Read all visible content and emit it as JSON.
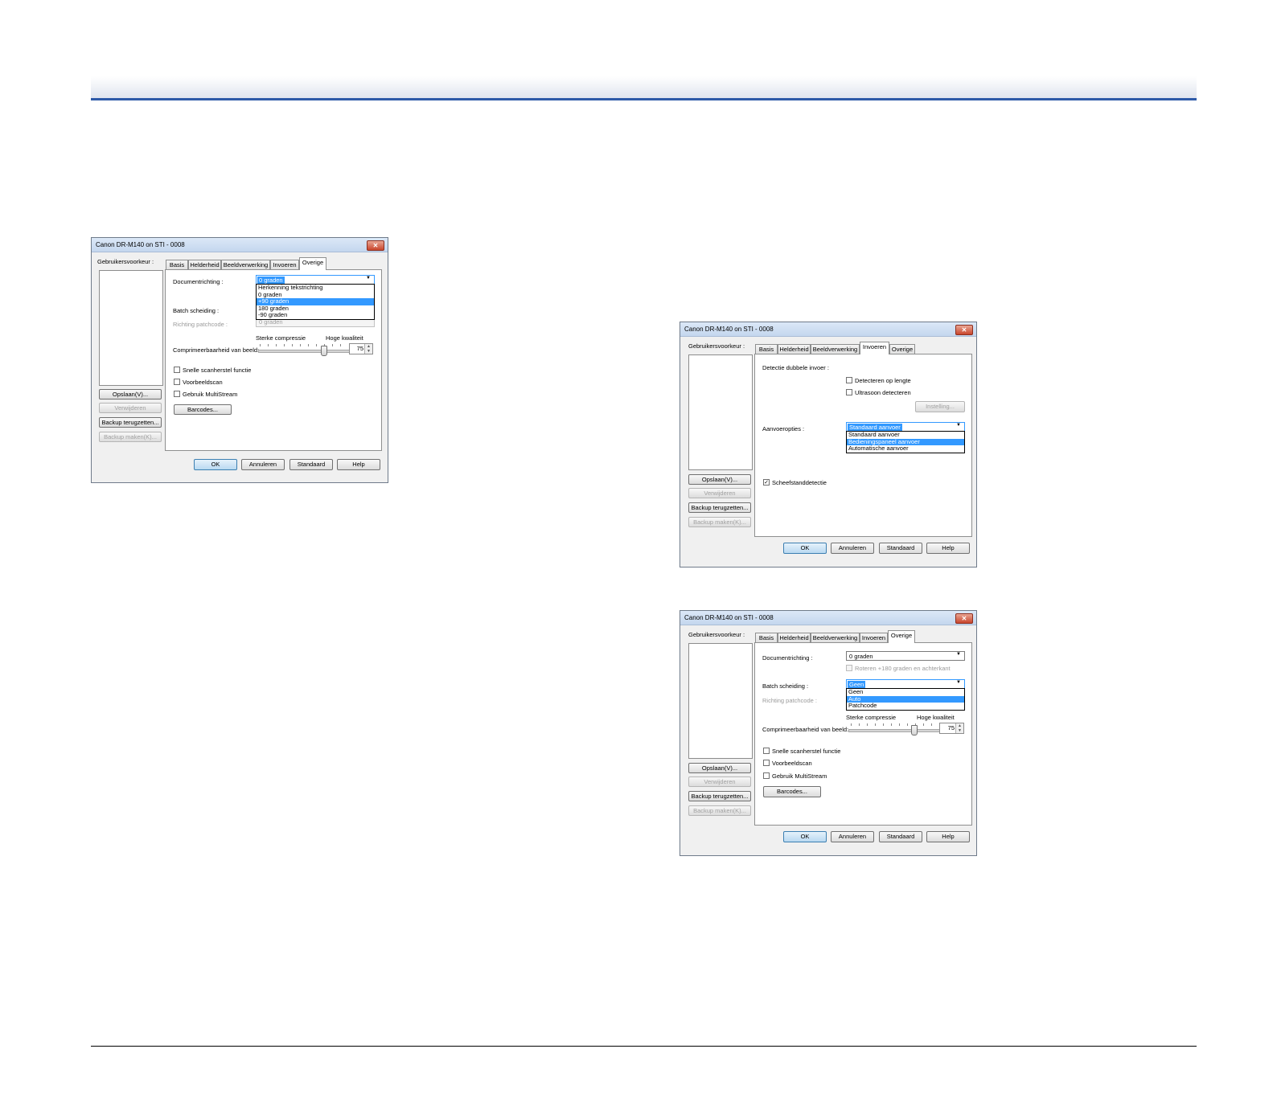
{
  "common": {
    "title": "Canon DR-M140 on STI - 0008",
    "close_glyph": "✕",
    "prefs_label": "Gebruikersvoorkeur :",
    "save_button": "Opslaan(V)...",
    "delete_button": "Verwijderen",
    "restore_backup_button": "Backup terugzetten...",
    "make_backup_button": "Backup maken(K)...",
    "tabs": [
      "Basis",
      "Helderheid",
      "Beeldverwerking",
      "Invoeren",
      "Overige"
    ],
    "ok_button": "OK",
    "cancel_button": "Annuleren",
    "default_button": "Standaard",
    "help_button": "Help"
  },
  "dialog1": {
    "active_tab": "Overige",
    "doc_orientation_label": "Documentrichting :",
    "doc_orientation_value": "0 graden",
    "doc_orientation_options": [
      "Herkenning tekstrichting",
      "0 graden",
      "+90 graden",
      "180 graden",
      "-90 graden"
    ],
    "doc_orientation_selected_index": 2,
    "batch_label": "Batch scheiding :",
    "patchcode_label": "Richting patchcode :",
    "patchcode_value": "0 graden",
    "compress_low_label": "Sterke compressie",
    "compress_high_label": "Hoge kwaliteit",
    "compress_label": "Comprimeerbaarheid van beeld:",
    "compress_value": "75",
    "checkboxes": [
      "Snelle scanherstel functie",
      "Voorbeeldscan",
      "Gebruik MultiStream"
    ],
    "barcodes_button": "Barcodes..."
  },
  "dialog2": {
    "active_tab": "Invoeren",
    "double_feed_label": "Detectie dubbele invoer :",
    "detect_length_label": "Detecteren op lengte",
    "ultrasonic_label": "Ultrasoon detecteren",
    "settings_button": "Instelling...",
    "feed_options_label": "Aanvoeropties :",
    "feed_options_value": "Standaard aanvoer",
    "feed_options": [
      "Standaard aanvoer",
      "Bedieningspaneel aanvoer",
      "Automatische aanvoer"
    ],
    "feed_options_selected_index": 1,
    "skew_label": "Scheefstanddetectie",
    "skew_checked": true
  },
  "dialog3": {
    "active_tab": "Overige",
    "doc_orientation_label": "Documentrichting :",
    "doc_orientation_value": "0 graden",
    "rotate_back_label": "Roteren +180 graden en achterkant",
    "batch_label": "Batch scheiding :",
    "batch_value": "Geen",
    "batch_options": [
      "Geen",
      "Auto",
      "Patchcode"
    ],
    "batch_selected_index": 1,
    "patchcode_label": "Richting patchcode :",
    "compress_low_label": "Sterke compressie",
    "compress_high_label": "Hoge kwaliteit",
    "compress_label": "Comprimeerbaarheid van beeld:",
    "compress_value": "75",
    "checkboxes": [
      "Snelle scanherstel functie",
      "Voorbeeldscan",
      "Gebruik MultiStream"
    ],
    "barcodes_button": "Barcodes..."
  }
}
